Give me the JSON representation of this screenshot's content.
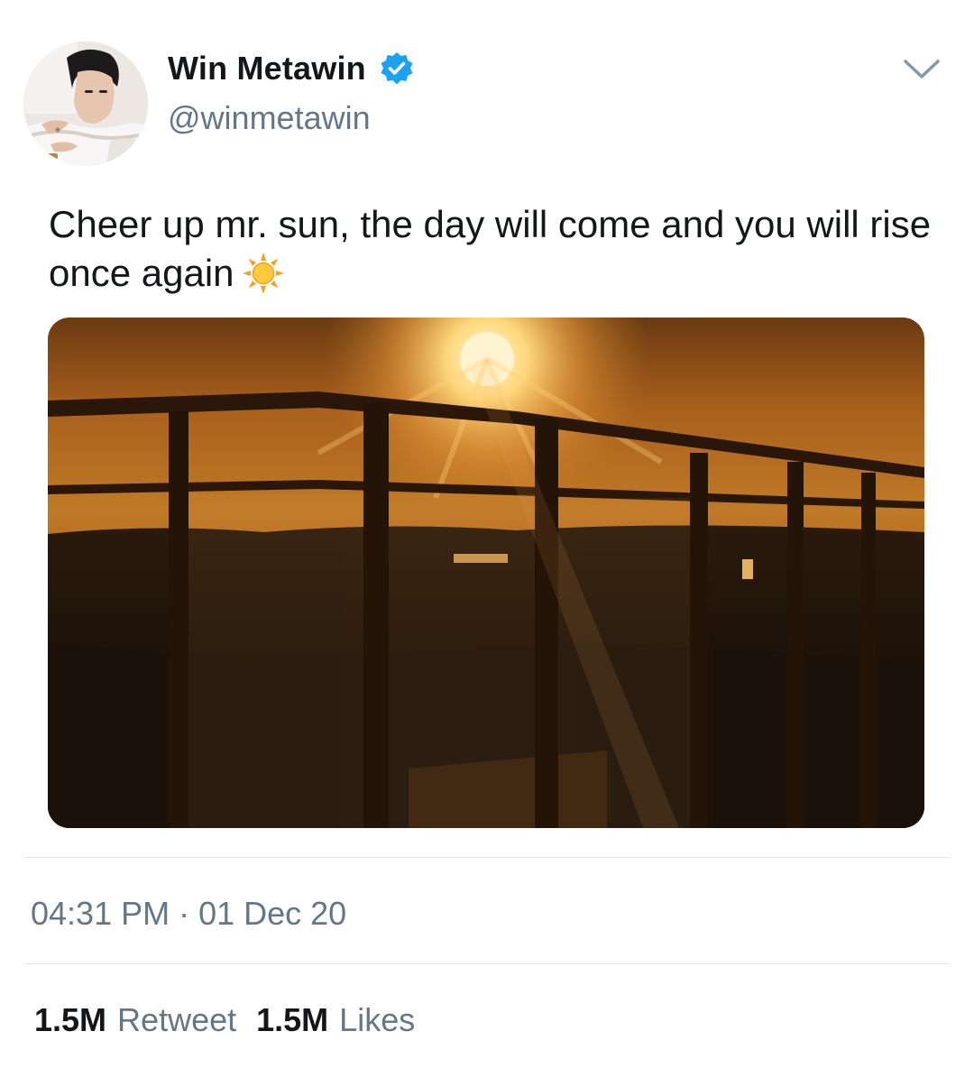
{
  "profile": {
    "display_name": "Win Metawin",
    "handle": "@winmetawin",
    "verified": true,
    "verified_color": "#1da1f2",
    "avatar_icon": "avatar"
  },
  "tweet": {
    "text": "Cheer up mr. sun, the day will come and you will rise once again",
    "emoji": "sun-emoji",
    "media_alt": "sunset-photo",
    "timestamp": "04:31 PM · 01 Dec 20"
  },
  "stats": {
    "retweets_count": "1.5M",
    "retweets_label": "Retweet",
    "likes_count": "1.5M",
    "likes_label": "Likes"
  },
  "colors": {
    "text_primary": "#14171a",
    "text_secondary": "#657786",
    "divider": "#e1e8ed"
  }
}
